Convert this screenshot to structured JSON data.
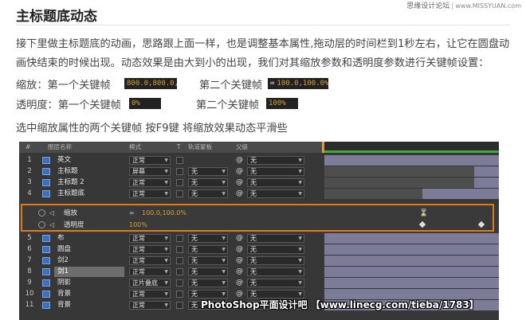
{
  "watermark": {
    "site": "思缘设计论坛",
    "url": "www.MISSYUAN.com"
  },
  "article": {
    "title": "主标题底动态",
    "paragraph": "接下里做主标题底的动画，思路跟上面一样，也是调整基本属性,拖动层的时间栏到1秒左右，让它在圆盘动画快结束的时候出现。动态效果是由大到小的出现，我们对其缩放参数和透明度参数进行关键帧设置：",
    "keyframes": [
      {
        "first_label": "缩放：第一个关键帧",
        "first_value": "800.0,800.0,",
        "second_label": "第二个关键帧",
        "second_value": "100.0,100.0%"
      },
      {
        "first_label": "透明度：第一个关键帧",
        "first_value": "0%",
        "second_label": "第二个关键帧",
        "second_value": "100%"
      }
    ],
    "note": "选中缩放属性的两个关键帧 按F9键 将缩放效果动态平滑些"
  },
  "panel": {
    "headers": {
      "num": "#",
      "name": "图层名称",
      "mode": "模式",
      "t": "T",
      "track": "轨道蒙板",
      "parent": "父级"
    },
    "layers": [
      {
        "num": "1",
        "name": "英文",
        "mode": "正常",
        "track": "",
        "parent": "无",
        "bar_start": 0.0
      },
      {
        "num": "2",
        "name": "主标题",
        "mode": "屏幕",
        "track": "无",
        "parent": "无",
        "bar_start": 0.86
      },
      {
        "num": "3",
        "name": "主标题 2",
        "mode": "正常",
        "track": "无",
        "parent": "无",
        "bar_start": 0.86
      },
      {
        "num": "4",
        "name": "主标题底",
        "mode": "正常",
        "track": "无",
        "parent": "无",
        "bar_start": 0.56
      },
      {
        "num": "5",
        "name": "布",
        "mode": "正常",
        "track": "无",
        "parent": "无",
        "bar_start": 0.0
      },
      {
        "num": "6",
        "name": "圆盘",
        "mode": "正常",
        "track": "无",
        "parent": "无",
        "bar_start": 0.0
      },
      {
        "num": "7",
        "name": "剑2",
        "mode": "正常",
        "track": "无",
        "parent": "无",
        "bar_start": 0.0
      },
      {
        "num": "8",
        "name": "剑1",
        "mode": "正常",
        "track": "无",
        "parent": "无",
        "bar_start": 0.0,
        "selected": true
      },
      {
        "num": "9",
        "name": "阴影",
        "mode": "正片叠底",
        "track": "无",
        "parent": "无",
        "bar_start": 0.0
      },
      {
        "num": "10",
        "name": "背景",
        "mode": "正常",
        "track": "无",
        "parent": "无",
        "bar_start": 0.0
      },
      {
        "num": "11",
        "name": "背景",
        "mode": "正常",
        "track": "无",
        "parent": "无",
        "bar_start": 0.0
      }
    ],
    "properties": [
      {
        "name": "缩放",
        "value": "100.0,100.0%",
        "linked": true
      },
      {
        "name": "透明度",
        "value": "100%",
        "linked": false
      }
    ],
    "scale_keyframes": [
      0.56
    ],
    "opacity_keyframes": [
      0.56,
      0.9
    ]
  },
  "credit": "PhotoShop平面设计吧 【www.linecg.com/tieba/1783】",
  "colors": {
    "highlight": "#e07a17",
    "value": "#d9a036",
    "layer_bar": "#7c7c98",
    "ruler": "#3ea83e"
  }
}
